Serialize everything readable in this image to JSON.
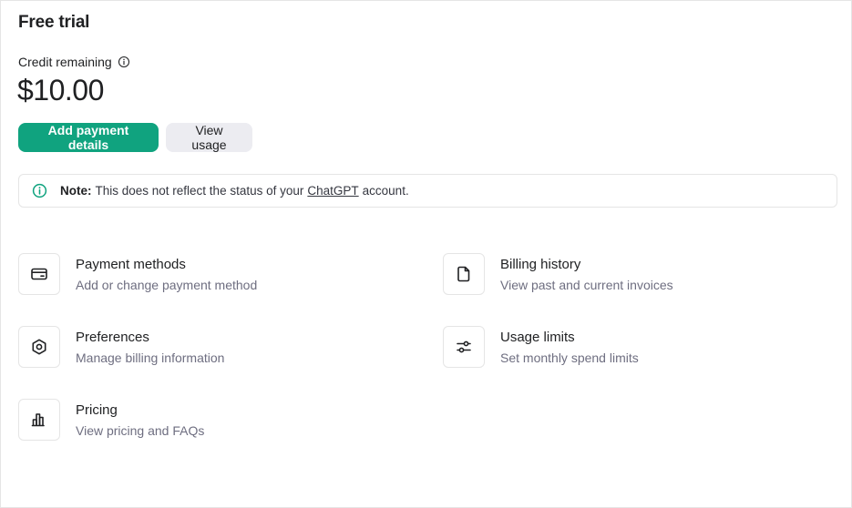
{
  "header": {
    "title": "Free trial"
  },
  "credit": {
    "label": "Credit remaining",
    "amount": "$10.00"
  },
  "actions": {
    "add_payment_label": "Add payment details",
    "view_usage_label": "View usage"
  },
  "note": {
    "prefix": "Note:",
    "text_before": "This does not reflect the status of your",
    "link": "ChatGPT",
    "text_after": "account."
  },
  "cards": [
    {
      "title": "Payment methods",
      "subtitle": "Add or change payment method",
      "icon": "credit-card-icon"
    },
    {
      "title": "Billing history",
      "subtitle": "View past and current invoices",
      "icon": "document-icon"
    },
    {
      "title": "Preferences",
      "subtitle": "Manage billing information",
      "icon": "gear-icon"
    },
    {
      "title": "Usage limits",
      "subtitle": "Set monthly spend limits",
      "icon": "sliders-icon"
    },
    {
      "title": "Pricing",
      "subtitle": "View pricing and FAQs",
      "icon": "bar-chart-icon"
    }
  ],
  "colors": {
    "accent": "#10a37f",
    "secondary_button": "#ececf1",
    "muted_text": "#6e6e80",
    "border": "#e5e5e5"
  }
}
